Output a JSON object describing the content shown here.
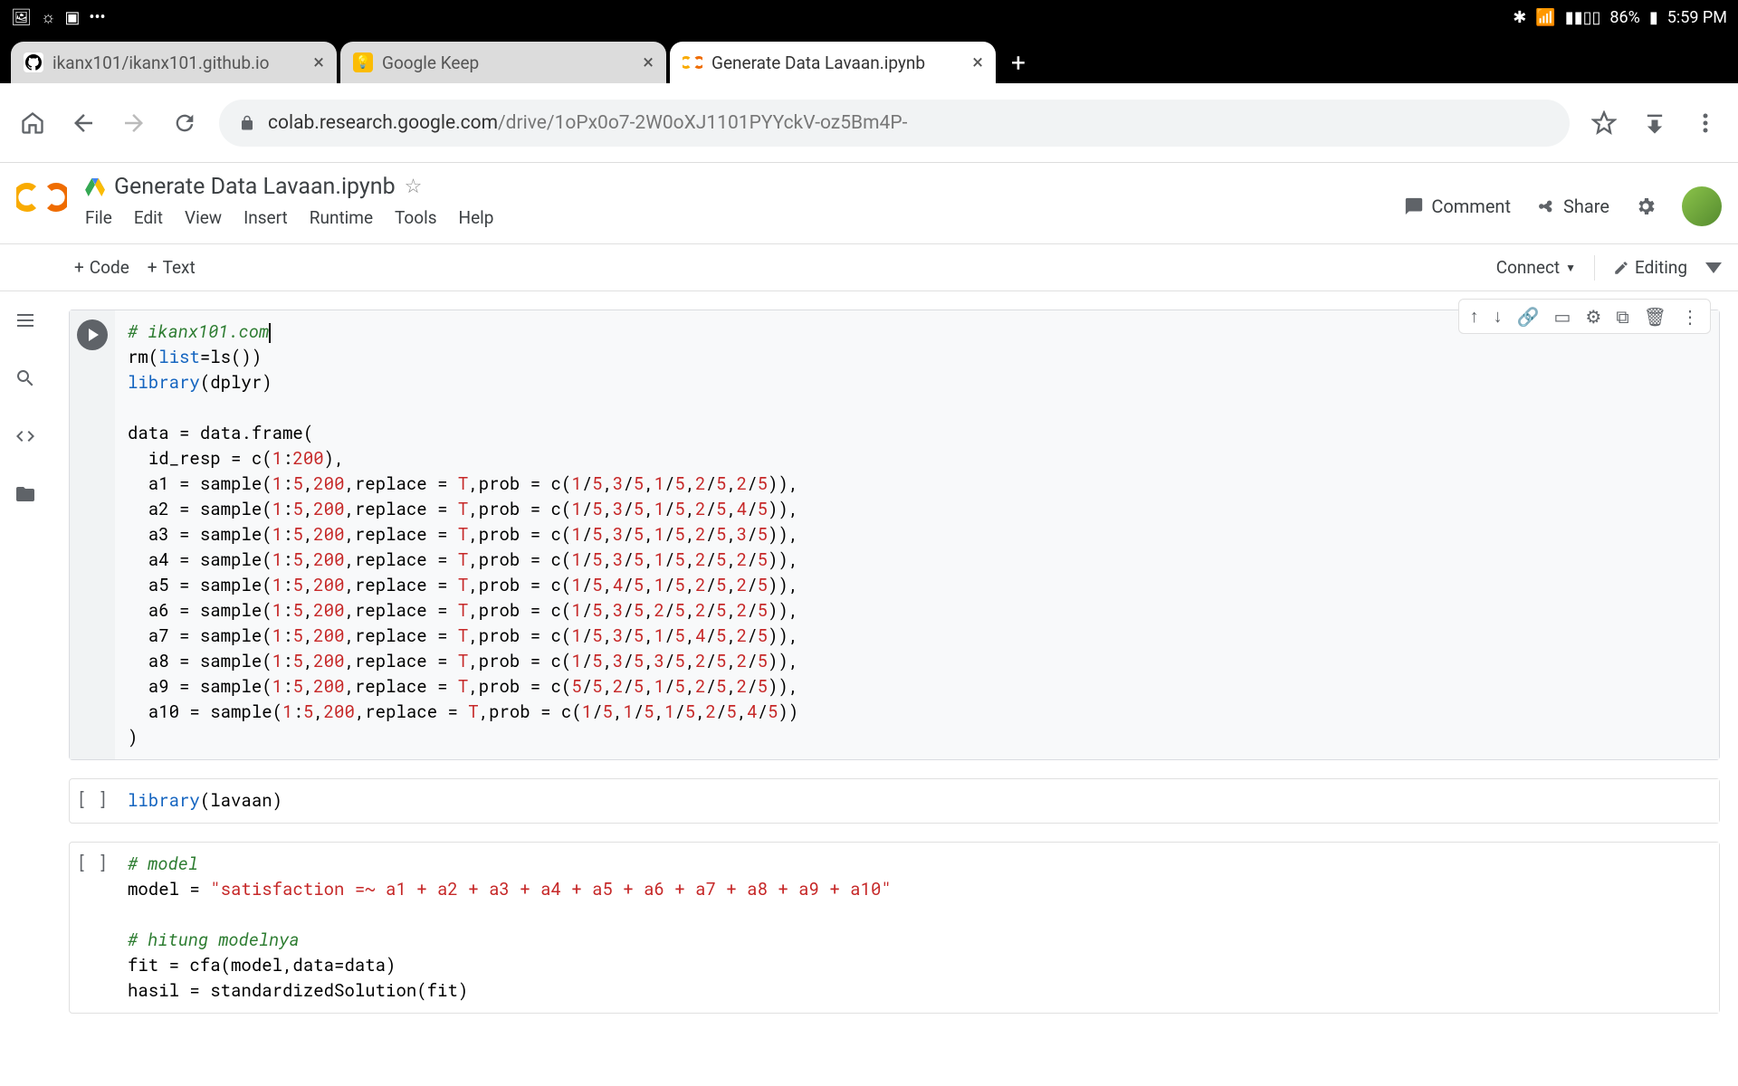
{
  "status_bar": {
    "battery": "86%",
    "time": "5:59 PM"
  },
  "tabs": [
    {
      "title": "ikanx101/ikanx101.github.io"
    },
    {
      "title": "Google Keep"
    },
    {
      "title": "Generate Data Lavaan.ipynb"
    }
  ],
  "url": {
    "domain": "colab.research.google.com",
    "path": "/drive/1oPx0o7-2W0oXJ1101PYYckV-oz5Bm4P-"
  },
  "colab": {
    "title": "Generate Data Lavaan.ipynb",
    "menus": [
      "File",
      "Edit",
      "View",
      "Insert",
      "Runtime",
      "Tools",
      "Help"
    ],
    "actions": {
      "comment": "Comment",
      "share": "Share"
    },
    "toolbar": {
      "code": "Code",
      "text": "Text",
      "connect": "Connect",
      "editing": "Editing"
    }
  },
  "cells": [
    {
      "state": "focused",
      "html": "<span class=\"c-comment\"># ikanx101.com</span><span class=\"cursor-caret\"></span>\nrm(<span class=\"c-keyword\">list</span>=ls())\n<span class=\"c-keyword\">library</span>(dplyr)\n\ndata = data.frame(\n  id_resp = c(<span class=\"c-num\">1</span>:<span class=\"c-num\">200</span>),\n  a1 = sample(<span class=\"c-num\">1</span>:<span class=\"c-num\">5</span>,<span class=\"c-num\">200</span>,replace = <span class=\"c-bool\">T</span>,prob = c(<span class=\"c-num\">1</span>/<span class=\"c-num\">5</span>,<span class=\"c-num\">3</span>/<span class=\"c-num\">5</span>,<span class=\"c-num\">1</span>/<span class=\"c-num\">5</span>,<span class=\"c-num\">2</span>/<span class=\"c-num\">5</span>,<span class=\"c-num\">2</span>/<span class=\"c-num\">5</span>)),\n  a2 = sample(<span class=\"c-num\">1</span>:<span class=\"c-num\">5</span>,<span class=\"c-num\">200</span>,replace = <span class=\"c-bool\">T</span>,prob = c(<span class=\"c-num\">1</span>/<span class=\"c-num\">5</span>,<span class=\"c-num\">3</span>/<span class=\"c-num\">5</span>,<span class=\"c-num\">1</span>/<span class=\"c-num\">5</span>,<span class=\"c-num\">2</span>/<span class=\"c-num\">5</span>,<span class=\"c-num\">4</span>/<span class=\"c-num\">5</span>)),\n  a3 = sample(<span class=\"c-num\">1</span>:<span class=\"c-num\">5</span>,<span class=\"c-num\">200</span>,replace = <span class=\"c-bool\">T</span>,prob = c(<span class=\"c-num\">1</span>/<span class=\"c-num\">5</span>,<span class=\"c-num\">3</span>/<span class=\"c-num\">5</span>,<span class=\"c-num\">1</span>/<span class=\"c-num\">5</span>,<span class=\"c-num\">2</span>/<span class=\"c-num\">5</span>,<span class=\"c-num\">3</span>/<span class=\"c-num\">5</span>)),\n  a4 = sample(<span class=\"c-num\">1</span>:<span class=\"c-num\">5</span>,<span class=\"c-num\">200</span>,replace = <span class=\"c-bool\">T</span>,prob = c(<span class=\"c-num\">1</span>/<span class=\"c-num\">5</span>,<span class=\"c-num\">3</span>/<span class=\"c-num\">5</span>,<span class=\"c-num\">1</span>/<span class=\"c-num\">5</span>,<span class=\"c-num\">2</span>/<span class=\"c-num\">5</span>,<span class=\"c-num\">2</span>/<span class=\"c-num\">5</span>)),\n  a5 = sample(<span class=\"c-num\">1</span>:<span class=\"c-num\">5</span>,<span class=\"c-num\">200</span>,replace = <span class=\"c-bool\">T</span>,prob = c(<span class=\"c-num\">1</span>/<span class=\"c-num\">5</span>,<span class=\"c-num\">4</span>/<span class=\"c-num\">5</span>,<span class=\"c-num\">1</span>/<span class=\"c-num\">5</span>,<span class=\"c-num\">2</span>/<span class=\"c-num\">5</span>,<span class=\"c-num\">2</span>/<span class=\"c-num\">5</span>)),\n  a6 = sample(<span class=\"c-num\">1</span>:<span class=\"c-num\">5</span>,<span class=\"c-num\">200</span>,replace = <span class=\"c-bool\">T</span>,prob = c(<span class=\"c-num\">1</span>/<span class=\"c-num\">5</span>,<span class=\"c-num\">3</span>/<span class=\"c-num\">5</span>,<span class=\"c-num\">2</span>/<span class=\"c-num\">5</span>,<span class=\"c-num\">2</span>/<span class=\"c-num\">5</span>,<span class=\"c-num\">2</span>/<span class=\"c-num\">5</span>)),\n  a7 = sample(<span class=\"c-num\">1</span>:<span class=\"c-num\">5</span>,<span class=\"c-num\">200</span>,replace = <span class=\"c-bool\">T</span>,prob = c(<span class=\"c-num\">1</span>/<span class=\"c-num\">5</span>,<span class=\"c-num\">3</span>/<span class=\"c-num\">5</span>,<span class=\"c-num\">1</span>/<span class=\"c-num\">5</span>,<span class=\"c-num\">4</span>/<span class=\"c-num\">5</span>,<span class=\"c-num\">2</span>/<span class=\"c-num\">5</span>)),\n  a8 = sample(<span class=\"c-num\">1</span>:<span class=\"c-num\">5</span>,<span class=\"c-num\">200</span>,replace = <span class=\"c-bool\">T</span>,prob = c(<span class=\"c-num\">1</span>/<span class=\"c-num\">5</span>,<span class=\"c-num\">3</span>/<span class=\"c-num\">5</span>,<span class=\"c-num\">3</span>/<span class=\"c-num\">5</span>,<span class=\"c-num\">2</span>/<span class=\"c-num\">5</span>,<span class=\"c-num\">2</span>/<span class=\"c-num\">5</span>)),\n  a9 = sample(<span class=\"c-num\">1</span>:<span class=\"c-num\">5</span>,<span class=\"c-num\">200</span>,replace = <span class=\"c-bool\">T</span>,prob = c(<span class=\"c-num\">5</span>/<span class=\"c-num\">5</span>,<span class=\"c-num\">2</span>/<span class=\"c-num\">5</span>,<span class=\"c-num\">1</span>/<span class=\"c-num\">5</span>,<span class=\"c-num\">2</span>/<span class=\"c-num\">5</span>,<span class=\"c-num\">2</span>/<span class=\"c-num\">5</span>)),\n  a10 = sample(<span class=\"c-num\">1</span>:<span class=\"c-num\">5</span>,<span class=\"c-num\">200</span>,replace = <span class=\"c-bool\">T</span>,prob = c(<span class=\"c-num\">1</span>/<span class=\"c-num\">5</span>,<span class=\"c-num\">1</span>/<span class=\"c-num\">5</span>,<span class=\"c-num\">1</span>/<span class=\"c-num\">5</span>,<span class=\"c-num\">2</span>/<span class=\"c-num\">5</span>,<span class=\"c-num\">4</span>/<span class=\"c-num\">5</span>))\n)"
    },
    {
      "state": "idle",
      "html": "<span class=\"c-keyword\">library</span>(lavaan)"
    },
    {
      "state": "idle",
      "html": "<span class=\"c-comment\"># model</span>\nmodel = <span class=\"c-str\">\"satisfaction =~ a1 + a2 + a3 + a4 + a5 + a6 + a7 + a8 + a9 + a10\"</span>\n\n<span class=\"c-comment\"># hitung modelnya</span>\nfit = cfa(model,data=data)\nhasil = standardizedSolution(fit)"
    }
  ]
}
